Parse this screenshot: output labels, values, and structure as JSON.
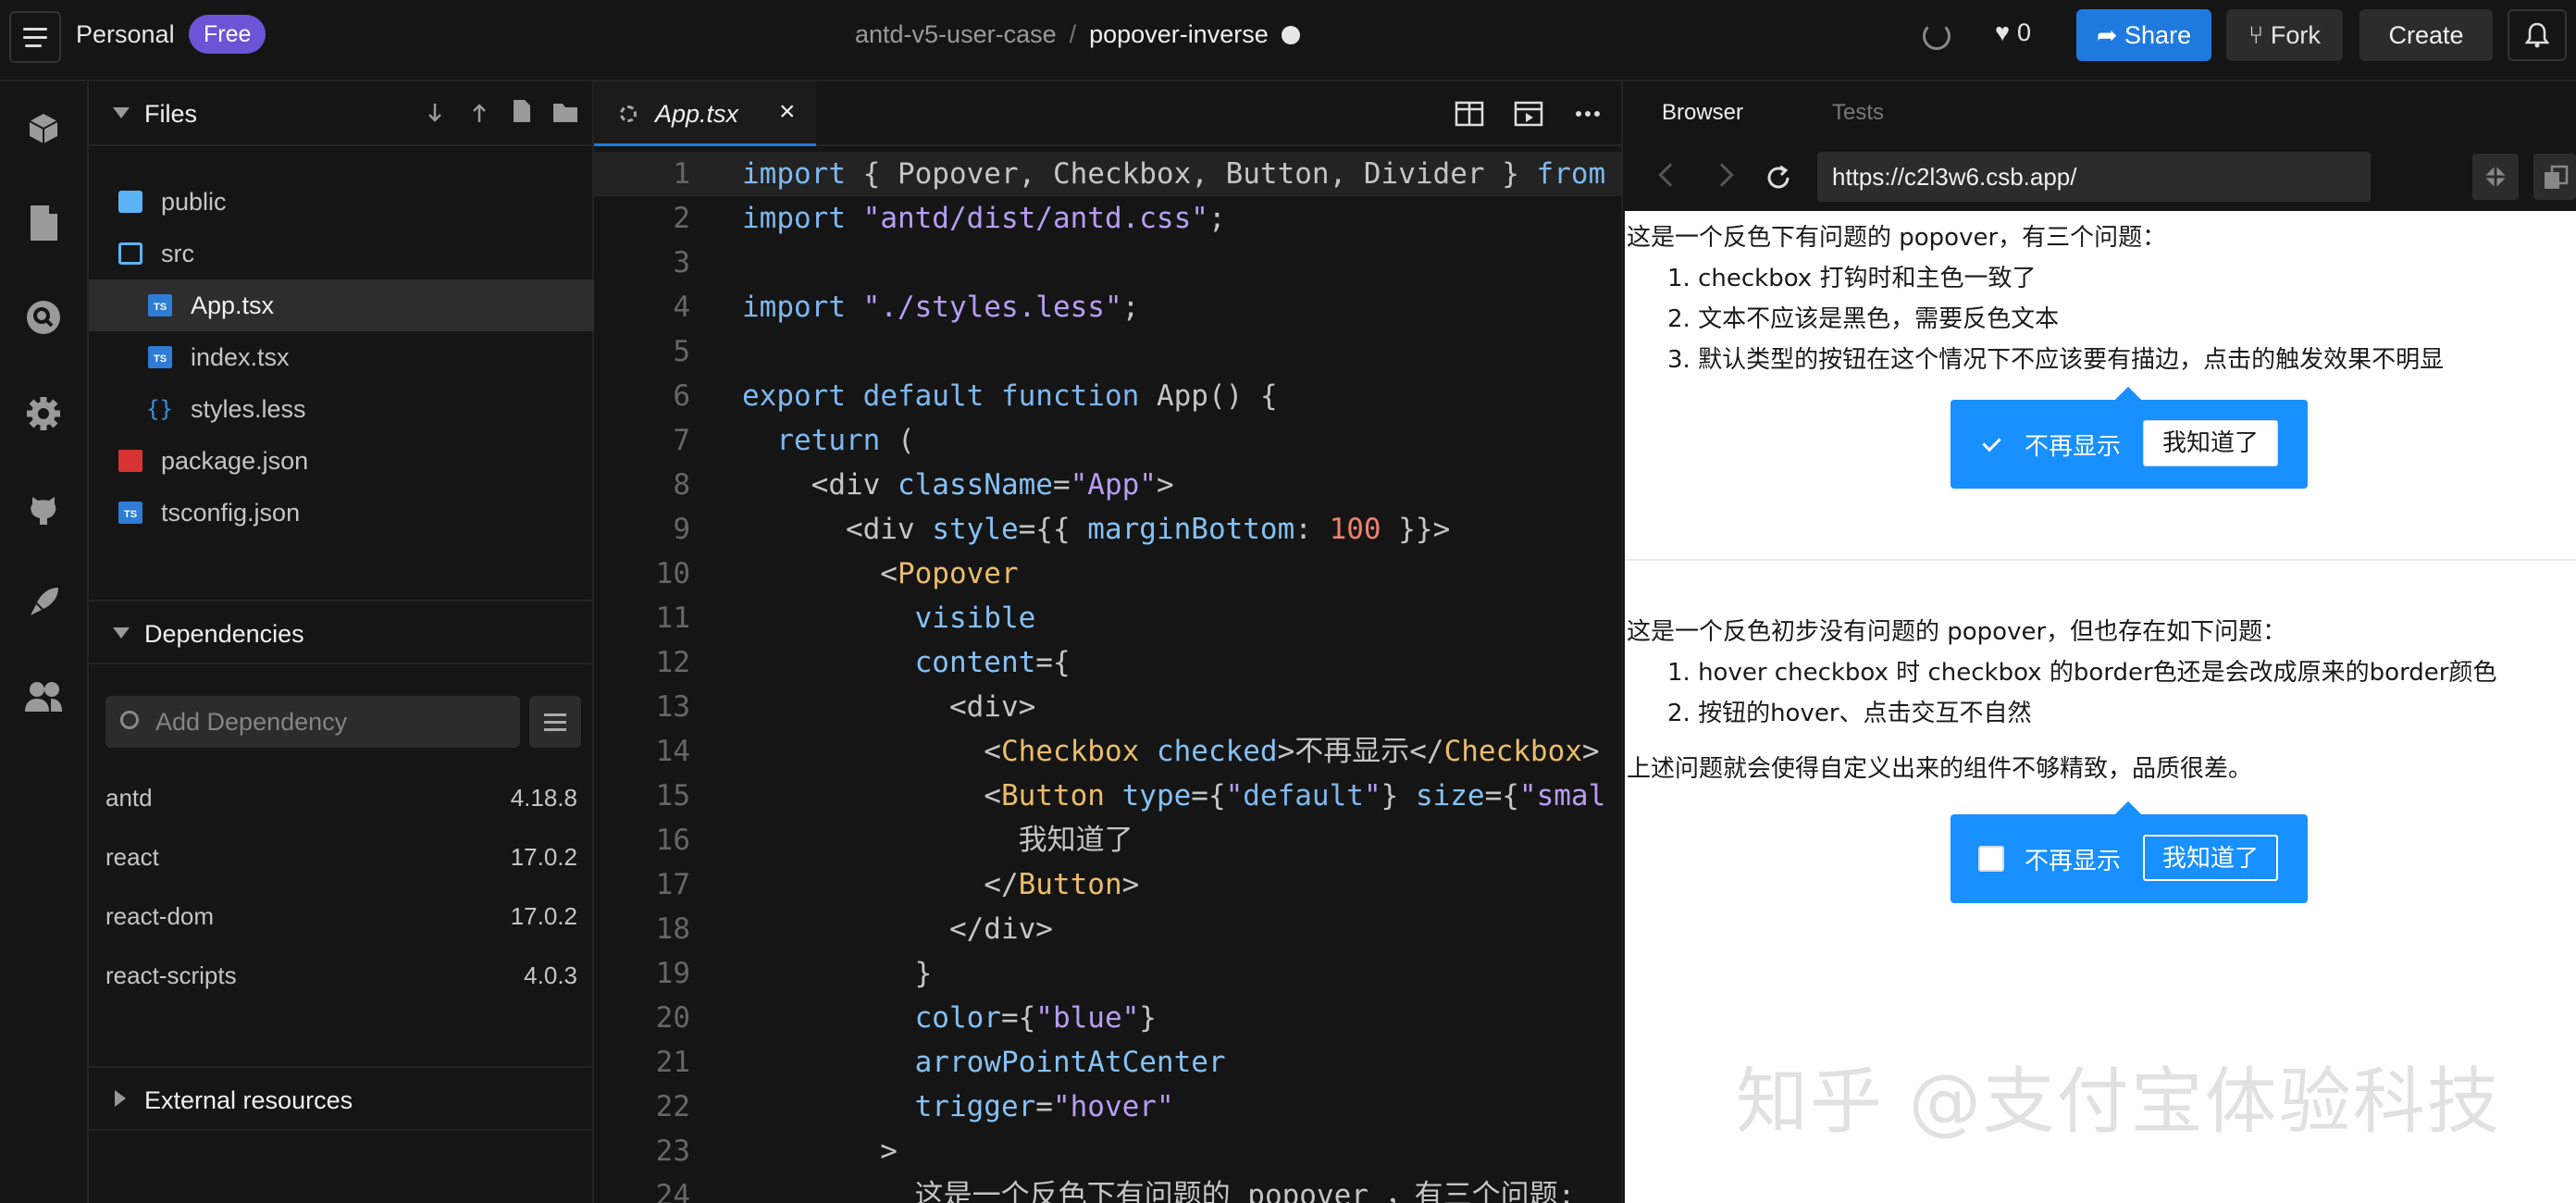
{
  "topbar": {
    "workspace": "Personal",
    "plan": "Free",
    "project": "antd-v5-user-case",
    "sandbox": "popover-inverse",
    "likes": "0",
    "share": "Share",
    "fork": "Fork",
    "create": "Create"
  },
  "files": {
    "header": "Files",
    "items": [
      {
        "name": "public",
        "icon": "folder-icon"
      },
      {
        "name": "src",
        "icon": "folder-open-icon"
      },
      {
        "name": "App.tsx",
        "icon": "typescript-file-icon"
      },
      {
        "name": "index.tsx",
        "icon": "typescript-file-icon"
      },
      {
        "name": "styles.less",
        "icon": "less-file-icon"
      },
      {
        "name": "package.json",
        "icon": "npm-icon"
      },
      {
        "name": "tsconfig.json",
        "icon": "typescript-file-icon"
      }
    ]
  },
  "dependencies": {
    "header": "Dependencies",
    "placeholder": "Add Dependency",
    "items": [
      {
        "name": "antd",
        "version": "4.18.8"
      },
      {
        "name": "react",
        "version": "17.0.2"
      },
      {
        "name": "react-dom",
        "version": "17.0.2"
      },
      {
        "name": "react-scripts",
        "version": "4.0.3"
      }
    ]
  },
  "external": {
    "header": "External resources"
  },
  "editor": {
    "tab": "App.tsx",
    "close": "×",
    "lines": [
      "import { Popover, Checkbox, Button, Divider } from",
      "import \"antd/dist/antd.css\";",
      "",
      "import \"./styles.less\";",
      "",
      "export default function App() {",
      "  return (",
      "    <div className=\"App\">",
      "      <div style={{ marginBottom: 100 }}>",
      "        <Popover",
      "          visible",
      "          content={",
      "            <div>",
      "              <Checkbox checked>不再显示</Checkbox>",
      "              <Button type={\"default\"} size={\"smal",
      "                我知道了",
      "              </Button>",
      "            </div>",
      "          }",
      "          color={\"blue\"}",
      "          arrowPointAtCenter",
      "          trigger=\"hover\"",
      "        >",
      "          这是一个反色下有问题的 popover ，有三个问题:"
    ]
  },
  "browser": {
    "tab_browser": "Browser",
    "tab_tests": "Tests",
    "url": "https://c2l3w6.csb.app/"
  },
  "preview": {
    "case1_intro": "这是一个反色下有问题的 popover，有三个问题：",
    "case1_items": [
      "1. checkbox 打钩时和主色一致了",
      "2. 文本不应该是黑色，需要反色文本",
      "3. 默认类型的按钮在这个情况下不应该要有描边，点击的触发效果不明显"
    ],
    "case2_intro": "这是一个反色初步没有问题的 popover，但也存在如下问题：",
    "case2_items": [
      "1. hover checkbox 时 checkbox 的border色还是会改成原来的border颜色",
      "2. 按钮的hover、点击交互不自然"
    ],
    "case2_note": "上述问题就会使得自定义出来的组件不够精致，品质很差。",
    "checkbox_label": "不再显示",
    "button_label": "我知道了"
  },
  "watermark": "知乎 @支付宝体验科技",
  "colors": {
    "accent": "#1f7ae0",
    "popover_blue": "#1890ff",
    "plan_badge": "#6b55d6"
  }
}
